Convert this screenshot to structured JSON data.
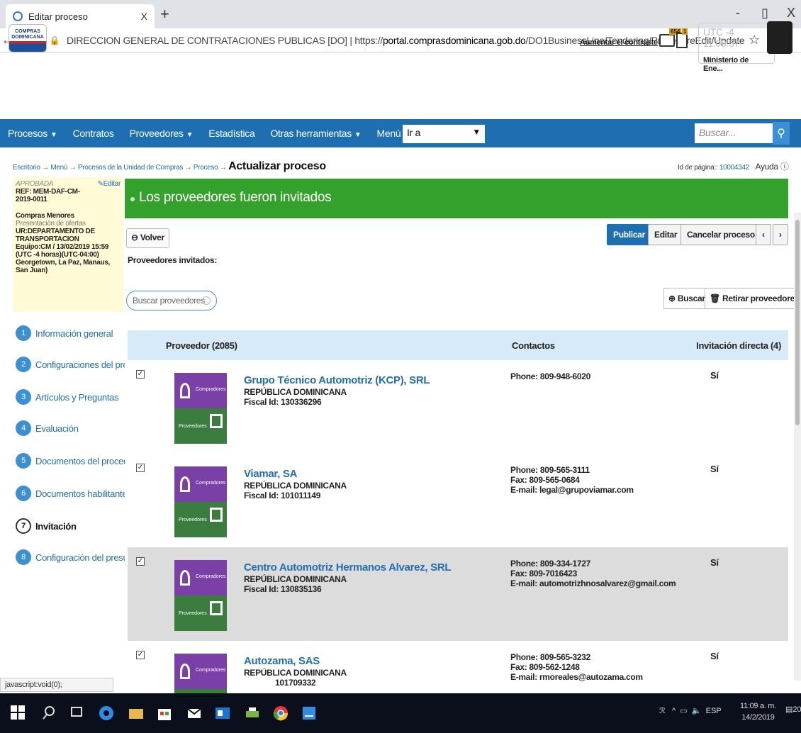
{
  "browser": {
    "tab_title": "Editar proceso",
    "tab_close": "X",
    "new_tab": "+",
    "minimize": "-",
    "restore": "▯",
    "close": "X",
    "site_name": "DIRECCION GENERAL DE CONTRATACIONES PUBLICAS [DO]",
    "url_prefix": "https://",
    "url_host": "portal.comprasdominicana.gob.do",
    "url_path": "/DO1BusinessLine/Tendering/ProcedureEdit/Update?docUniqueIdentifier...",
    "status_text": "javascript:void(0);"
  },
  "header": {
    "logo_text": "COMPRAS DOMINICANA",
    "contrast_link": "Aumentar el contraste",
    "mail_badge": "654",
    "doc_badge": "1",
    "utc_label": "UTC -4",
    "time": "11:09:57",
    "org": "Ministerio de Ene..."
  },
  "nav": {
    "items": [
      "Procesos",
      "Contratos",
      "Proveedores",
      "Estadística",
      "Otras herramientas",
      "Menú"
    ],
    "ira": "Ir a",
    "search_placeholder": "Buscar..."
  },
  "breadcrumb": {
    "items": [
      "Escritorio",
      "Menú",
      "Procesos de la Unidad de Compras",
      "Proceso"
    ],
    "sep": "→",
    "current": "Actualizar proceso",
    "page_id_label": "Id de página::",
    "page_id": "10004342",
    "help": "Ayuda"
  },
  "left": {
    "status": "APROBADA",
    "edit": "Editar",
    "ref": "REF: MEM-DAF-CM-2019-0011",
    "type": "Compras Menores",
    "phase": "Presentación de ofertas",
    "ur": "UR:DEPARTAMENTO DE TRANSPORTACION",
    "team": "Equipo:CM / 13/02/2019 15:59 (UTC -4 horas)(UTC-04:00) Georgetown, La Paz, Manaus, San Juan)",
    "steps": [
      {
        "num": "1",
        "label": "Información general"
      },
      {
        "num": "2",
        "label": "Configuraciones del proc..."
      },
      {
        "num": "3",
        "label": "Artículos y Preguntas"
      },
      {
        "num": "4",
        "label": "Evaluación"
      },
      {
        "num": "5",
        "label": "Documentos del procedi..."
      },
      {
        "num": "6",
        "label": "Documentos habilitantes"
      },
      {
        "num": "7",
        "label": "Invitación"
      },
      {
        "num": "8",
        "label": "Configuración del presup..."
      }
    ]
  },
  "main": {
    "banner": "Los proveedores fueron invitados",
    "back": "Volver",
    "buttons": {
      "publish": "Publicar",
      "edit": "Editar",
      "cancel": "Cancelar proceso",
      "prev": "‹",
      "next": "›"
    },
    "invited_title": "Proveedores invitados:",
    "search_suppliers": "Buscar proveedores",
    "search_btn": "Buscar",
    "remove_btn": "Retirar proveedores",
    "table": {
      "col_supplier": "Proveedor (2085)",
      "col_contacts": "Contactos",
      "col_invite": "Invitación directa (4)"
    },
    "img_top": "Compradores",
    "img_bottom": "Proveedores",
    "rows": [
      {
        "name": "Grupo Técnico Automotriz (KCP), SRL",
        "country": "REPÚBLICA DOMINICANA",
        "fiscal": "Fiscal Id: 130336296",
        "phone": "Phone: 809-948-6020",
        "fax": "",
        "email": "",
        "invite": "Sí"
      },
      {
        "name": "Viamar, SA",
        "country": "REPÚBLICA DOMINICANA",
        "fiscal": "Fiscal Id: 101011149",
        "phone": "Phone: 809-565-3111",
        "fax": "Fax: 809-565-0684",
        "email": "E-mail: legal@grupoviamar.com",
        "invite": "Sí"
      },
      {
        "name": "Centro Automotriz Hermanos Alvarez, SRL",
        "country": "REPÚBLICA DOMINICANA",
        "fiscal": "Fiscal Id: 130835136",
        "phone": "Phone: 809-334-1727",
        "fax": "Fax: 809-7016423",
        "email": "E-mail: automotrizhnosalvarez@gmail.com",
        "invite": "Sí"
      },
      {
        "name": "Autozama, SAS",
        "country": "REPÚBLICA DOMINICANA",
        "fiscal": "101709332",
        "phone": "Phone: 809-565-3232",
        "fax": "Fax: 809-562-1248",
        "email": "E-mail: rmoreales@autozama.com",
        "invite": "Sí"
      }
    ]
  },
  "taskbar": {
    "tray": "ESP",
    "time": "11:09 a. m.",
    "date": "14/2/2019",
    "notif": "20"
  },
  "colors": {
    "nav_blue": "#1d6fb2",
    "banner_green": "#35a12d",
    "header_light_blue": "#d6ebf7"
  }
}
